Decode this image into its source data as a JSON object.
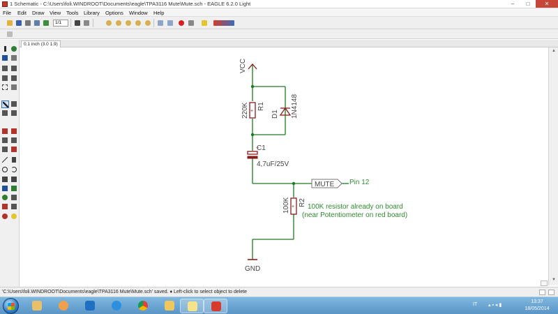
{
  "window": {
    "title": "1 Schematic - C:\\Users\\foli.WINDROOT\\Documents\\eagle\\TPA3116 Mute\\Mute.sch - EAGLE 6.2.0 Light",
    "min_label": "–",
    "max_label": "□",
    "close_label": "✕"
  },
  "menu": [
    "File",
    "Edit",
    "Draw",
    "View",
    "Tools",
    "Library",
    "Options",
    "Window",
    "Help"
  ],
  "toolbar": {
    "grid_value": "1/1",
    "icons": [
      "open-icon",
      "save-icon",
      "print-icon",
      "cam-icon",
      "board-icon",
      "script-icon",
      "run-ulp-icon",
      "layer-icon",
      "zoom-fit-icon",
      "zoom-in-icon",
      "zoom-out-icon",
      "zoom-redraw-icon",
      "zoom-select-icon",
      "undo-icon",
      "redo-icon",
      "stop-icon",
      "go-icon",
      "help-icon",
      "design-link-icon"
    ]
  },
  "coords_tab": "0.1 inch (3.0 1.9)",
  "schematic": {
    "vcc_label": "VCC",
    "gnd_label": "GND",
    "r1_name": "R1",
    "r1_value": "220K",
    "d1_name": "D1",
    "d1_value": "1N4148",
    "c1_name": "C1",
    "c1_value": "4,7uF/25V",
    "c1_plus": "+",
    "mute_label": "MUTE",
    "pin_label": "Pin 12",
    "r2_name": "R2",
    "r2_value": "100K",
    "note_line1": "100K resistor already on board",
    "note_line2": "(near Potentiometer on red board)",
    "wire_color": "#1e7a1e",
    "part_color": "#8b1a1a",
    "text_color": "#444444",
    "note_color": "#2e8b2e"
  },
  "status": {
    "text": "'C:\\Users\\foli.WINDROOT\\Documents\\eagle\\TPA3116 Mute\\Mute.sch' saved.  ♦ Left-click to select object to delete"
  },
  "taskbar": {
    "apps": [
      "explorer-icon",
      "media-player-icon",
      "paint-icon",
      "maxthon-icon",
      "internet-explorer-icon",
      "chrome-icon",
      "folder-icon",
      "notes-icon",
      "eagle-icon"
    ],
    "lang": "IT",
    "time": "13:37",
    "date": "18/05/2014"
  }
}
